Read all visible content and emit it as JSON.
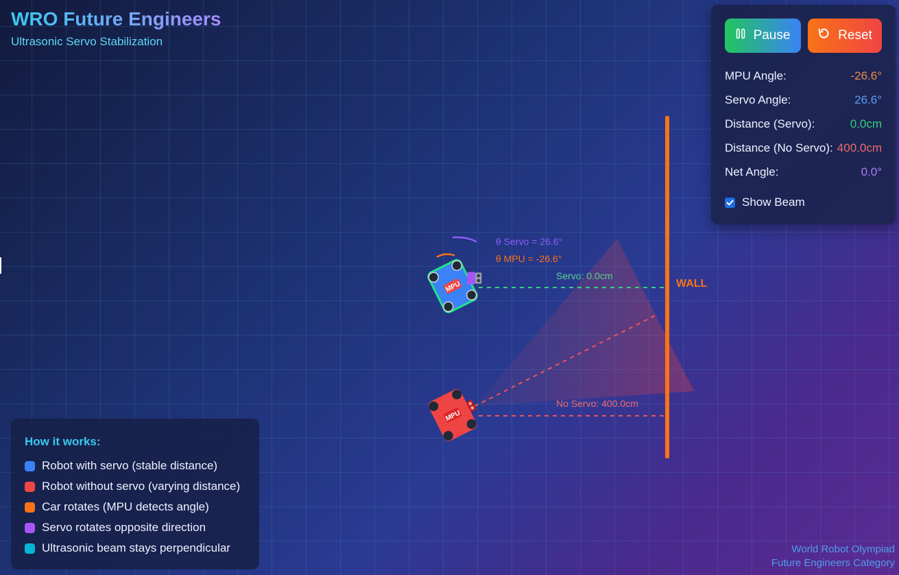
{
  "app": {
    "title": "WRO Future Engineers",
    "subtitle": "Ultrasonic Servo Stabilization"
  },
  "controls": {
    "pause_label": "Pause",
    "reset_label": "Reset",
    "show_beam_label": "Show Beam",
    "show_beam_checked": true
  },
  "stats": {
    "mpu_angle": {
      "label": "MPU Angle:",
      "value": "-26.6°",
      "color": "#f08a4b"
    },
    "servo_angle": {
      "label": "Servo Angle:",
      "value": "26.6°",
      "color": "#5b9ef0"
    },
    "distance_servo": {
      "label": "Distance (Servo):",
      "value": "0.0cm",
      "color": "#34d07a"
    },
    "distance_no_servo": {
      "label": "Distance (No Servo):",
      "value": "400.0cm",
      "color": "#ef6a6a"
    },
    "net_angle": {
      "label": "Net Angle:",
      "value": "0.0°",
      "color": "#b07cf7"
    }
  },
  "scene": {
    "wall_label": "WALL",
    "servo_angle_label": "θ Servo = 26.6°",
    "mpu_angle_label": "θ MPU = -26.6°",
    "servo_distance_label": "Servo: 0.0cm",
    "no_servo_distance_label": "No Servo: 400.0cm",
    "chip_label": "MPU",
    "car_rotation_deg": -26.6,
    "servo_rotation_deg": 26.6,
    "colors": {
      "wall": "#f97316",
      "servo_robot": "#3b82f6",
      "servo_robot_outline": "#22e08a",
      "no_servo_robot": "#ef4444",
      "servo_beam": "#34d07a",
      "no_servo_beam": "#ef5555",
      "arc_servo": "#8b5cf6",
      "arc_mpu": "#f97316"
    }
  },
  "legend": {
    "title": "How it works:",
    "items": [
      {
        "label": "Robot with servo (stable distance)",
        "color": "#3b82f6"
      },
      {
        "label": "Robot without servo (varying distance)",
        "color": "#ef4444"
      },
      {
        "label": "Car rotates (MPU detects angle)",
        "color": "#f97316"
      },
      {
        "label": "Servo rotates opposite direction",
        "color": "#a855f7"
      },
      {
        "label": "Ultrasonic beam stays perpendicular",
        "color": "#06b6d4"
      }
    ]
  },
  "footer": {
    "line1": "World Robot Olympiad",
    "line2": "Future Engineers Category"
  }
}
